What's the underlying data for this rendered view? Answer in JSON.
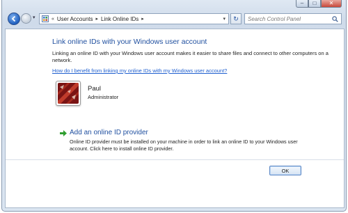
{
  "window": {
    "caption_buttons": {
      "minimize": "–",
      "maximize": "□",
      "close": "✕"
    }
  },
  "nav": {
    "recent_dropdown": "▾",
    "address": {
      "prefix": "«",
      "segments": [
        "User Accounts",
        "Link Online IDs"
      ],
      "separator": "▸",
      "dropdown": "▾"
    },
    "refresh": "↻",
    "search": {
      "placeholder": "Search Control Panel"
    }
  },
  "main": {
    "title": "Link online IDs with your Windows user account",
    "description": "Linking an online ID with your Windows user account makes it easier to share files and connect to other computers on a network.",
    "help_link": "How do I benefit from linking my online IDs with my Windows user account?",
    "user": {
      "name": "Paul",
      "role": "Administrator"
    },
    "add_provider": {
      "title": "Add an online ID provider",
      "description": "Online ID provider must be installed on your machine in order to link an online ID to your Windows user account. Click here to install online ID provider."
    },
    "ok_label": "OK"
  },
  "colors": {
    "title_blue": "#1f4f9f",
    "link_blue": "#1f5fcf",
    "arrow_green": "#2f9e2f"
  }
}
